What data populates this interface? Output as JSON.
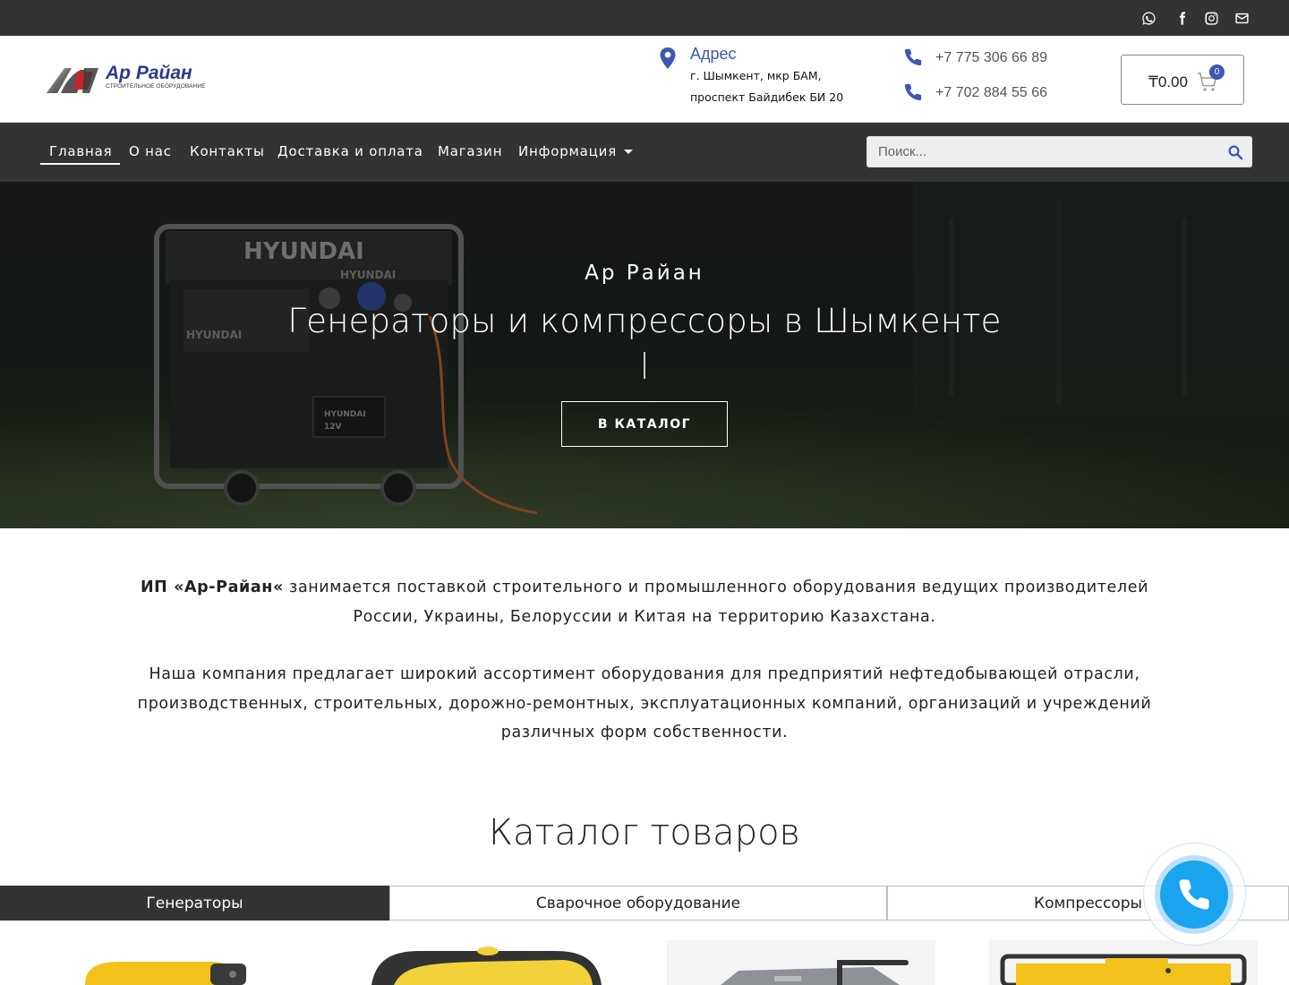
{
  "topbar": {
    "social": [
      "whatsapp-icon",
      "facebook-icon",
      "instagram-icon",
      "mail-icon"
    ]
  },
  "brand": {
    "name": "Ар Райан",
    "tagline": "СТРОИТЕЛЬНОЕ ОБОРУДОВАНИЕ"
  },
  "contact": {
    "address_title": "Адрес",
    "address_line1": "г. Шымкент, мкр БАМ,",
    "address_line2": "проспект Байдибек БИ 20",
    "phone1": "+7 775 306 66 89",
    "phone2": "+7 702 884 55 66"
  },
  "cart": {
    "total": "₸0.00",
    "count": "0"
  },
  "nav": {
    "items": [
      {
        "label": "Главная",
        "active": true
      },
      {
        "label": "О нас"
      },
      {
        "label": "Контакты"
      },
      {
        "label": "Доставка и оплата"
      },
      {
        "label": "Магазин"
      },
      {
        "label": "Информация"
      }
    ],
    "search_placeholder": "Поиск..."
  },
  "hero": {
    "kicker": "Ар Райан",
    "title": "Генераторы и компрессоры в Шымкенте",
    "button": "В КАТАЛОГ",
    "image_text": [
      "HYUNDAI",
      "HYUNDAI",
      "HYUNDAI",
      "HYUNDAI",
      "12V"
    ]
  },
  "intro": {
    "company_strong": "ИП «Ар-Райан«",
    "paragraph1_rest": " занимается поставкой строительного и промышленного оборудования ведущих производителей России, Украины, Белоруссии и Китая на территорию Казахстана.",
    "paragraph2": "Наша компания предлагает широкий ассортимент оборудования для предприятий нефтедобывающей отрасли, производственных, строительных, дорожно-ремонтных, эксплуатационных компаний, организаций и учреждений различных форм собственности."
  },
  "catalog": {
    "title": "Каталог товаров",
    "tabs": [
      {
        "label": "Генераторы",
        "active": true
      },
      {
        "label": "Сварочное оборудование"
      },
      {
        "label": "Компрессоры"
      }
    ]
  },
  "colors": {
    "dark": "#333333",
    "accent": "#3e56b4",
    "call": "#1aa4f0",
    "yellow": "#f2c21b"
  }
}
